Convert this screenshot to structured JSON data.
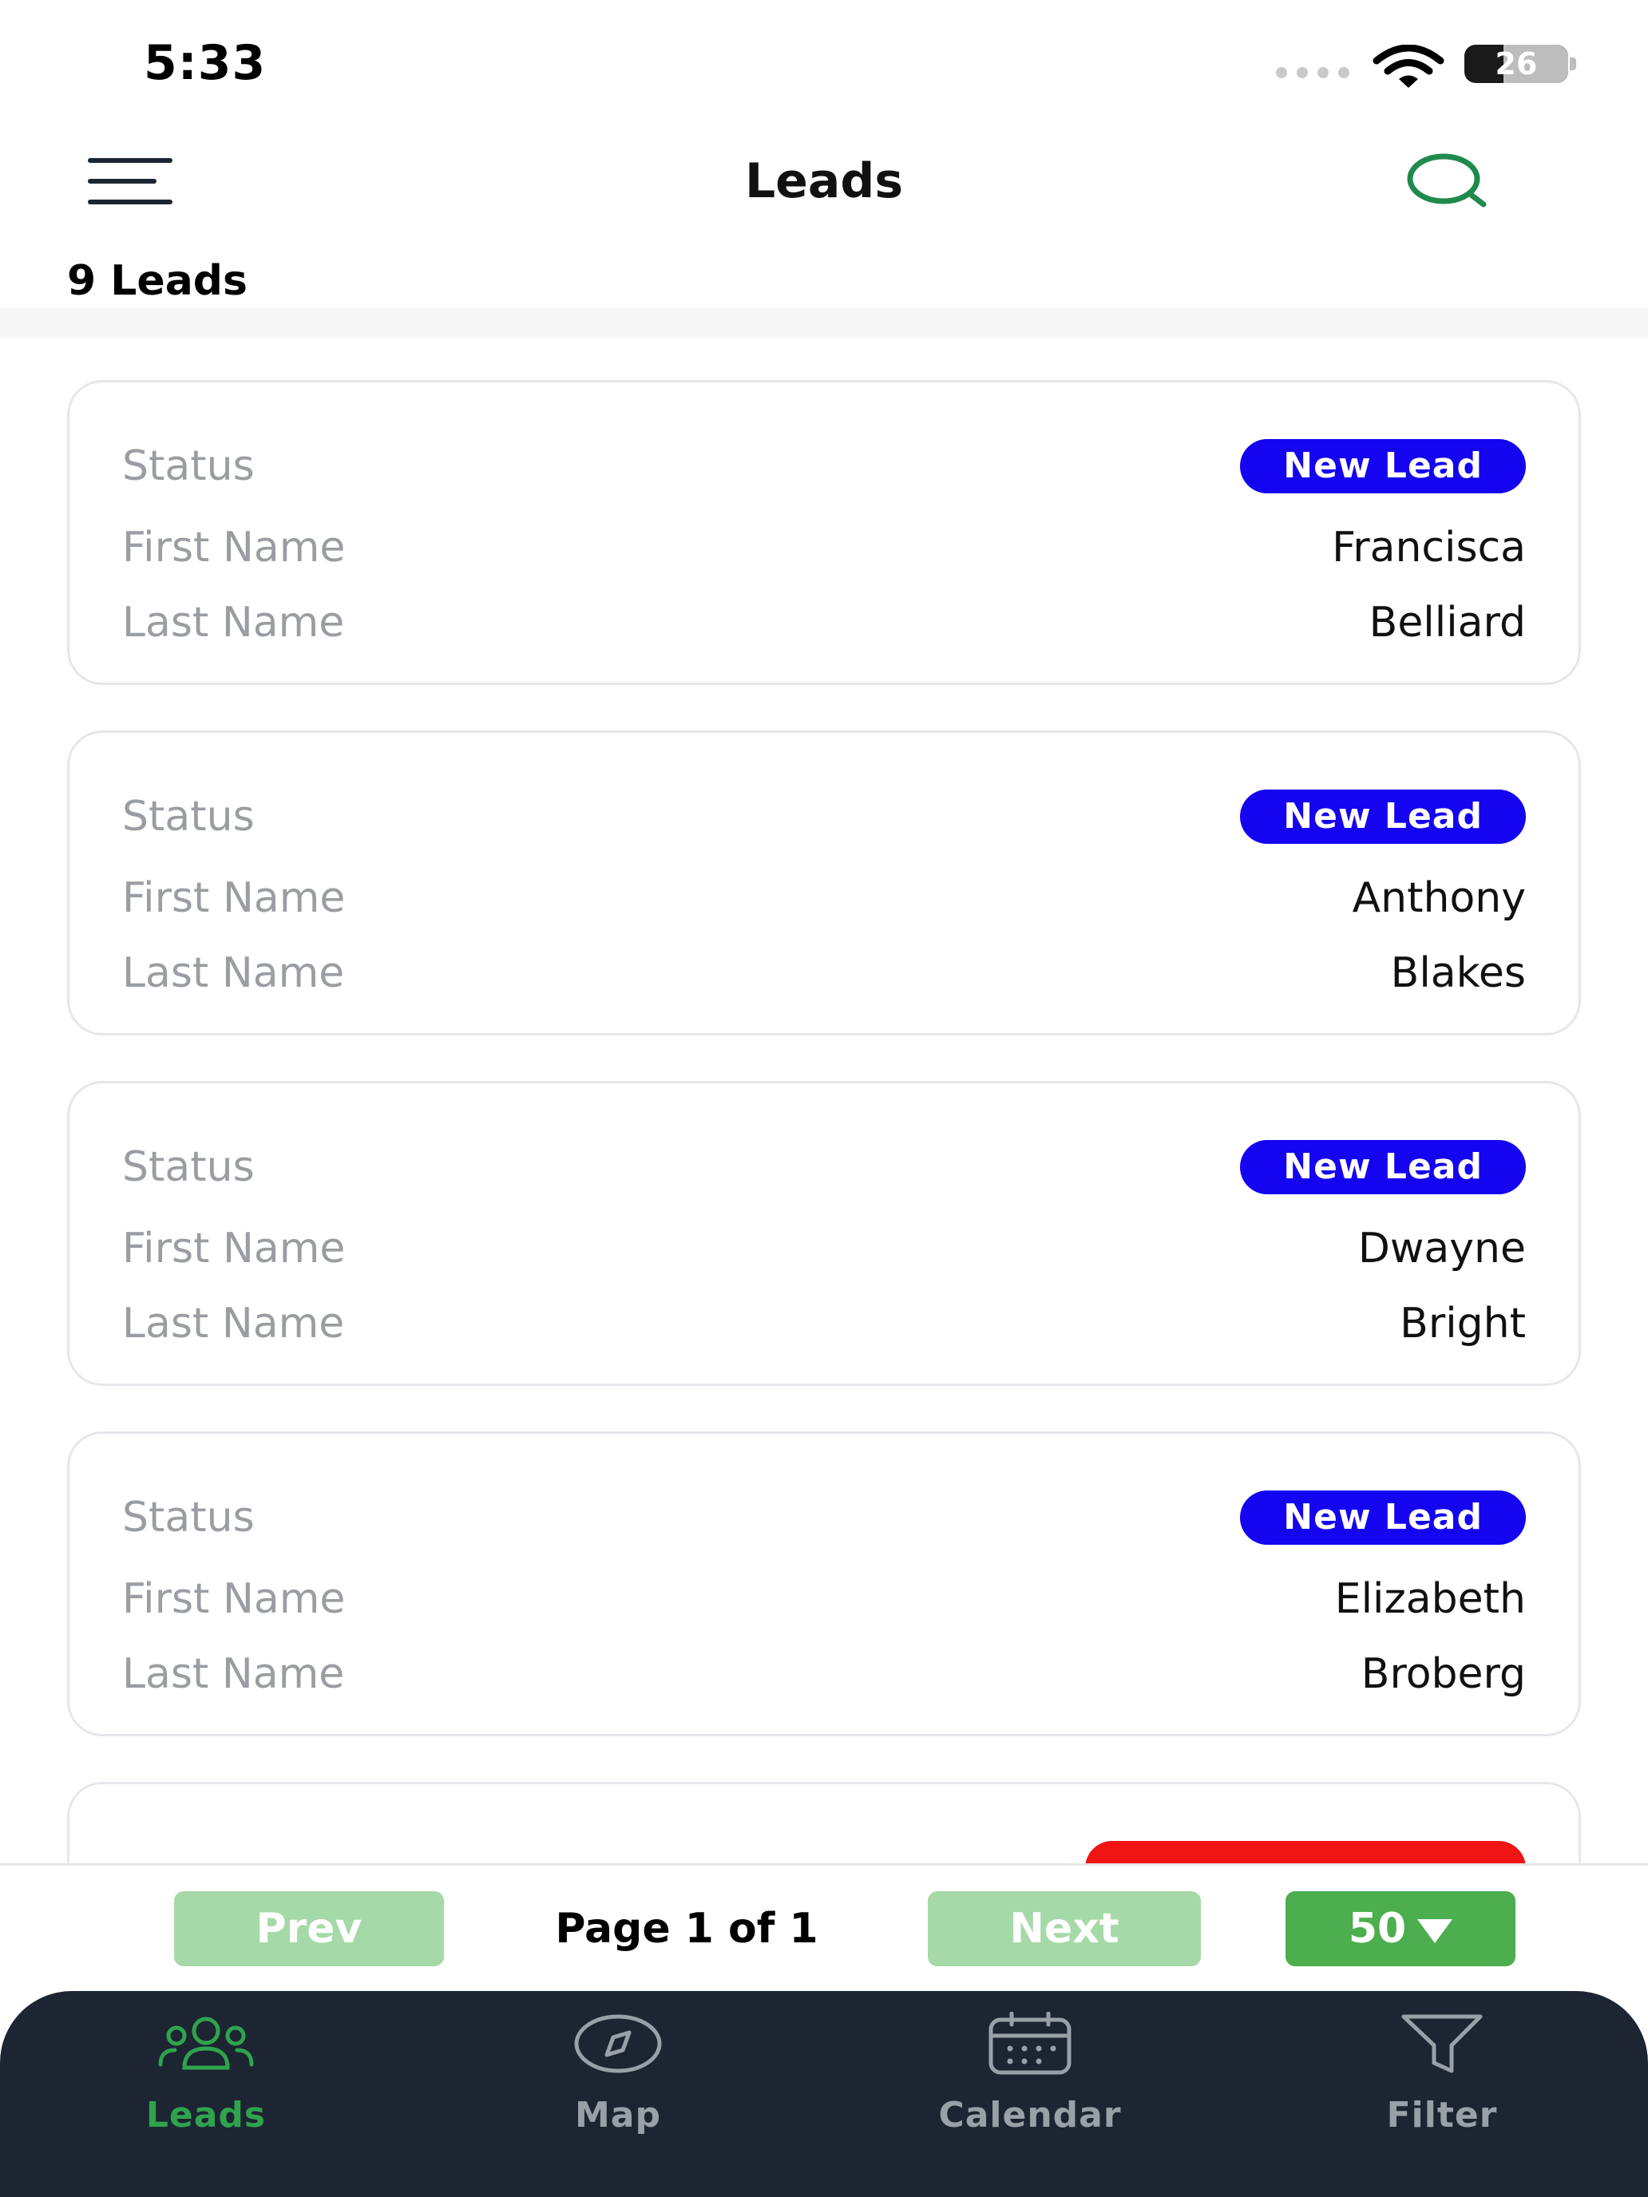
{
  "status_bar": {
    "time": "5:33",
    "battery": "26"
  },
  "header": {
    "title": "Leads"
  },
  "lead_count": "9 Leads",
  "labels": {
    "status": "Status",
    "first_name": "First Name",
    "last_name": "Last Name"
  },
  "colors": {
    "new_lead": "#1404f0",
    "appointment": "#f01414",
    "accent_green": "#2fa34d"
  },
  "leads": [
    {
      "status": "New Lead",
      "first_name": "Francisca",
      "last_name": "Belliard"
    },
    {
      "status": "New Lead",
      "first_name": "Anthony",
      "last_name": "Blakes"
    },
    {
      "status": "New Lead",
      "first_name": "Dwayne",
      "last_name": "Bright"
    },
    {
      "status": "New Lead",
      "first_name": "Elizabeth",
      "last_name": "Broberg"
    }
  ],
  "pagination": {
    "prev": "Prev",
    "page_info": "Page 1 of 1",
    "next": "Next",
    "page_size": "50"
  },
  "bottom_nav": [
    {
      "label": "Leads",
      "icon": "users-icon",
      "active": true
    },
    {
      "label": "Map",
      "icon": "compass-icon",
      "active": false
    },
    {
      "label": "Calendar",
      "icon": "calendar-icon",
      "active": false
    },
    {
      "label": "Filter",
      "icon": "filter-icon",
      "active": false
    }
  ]
}
